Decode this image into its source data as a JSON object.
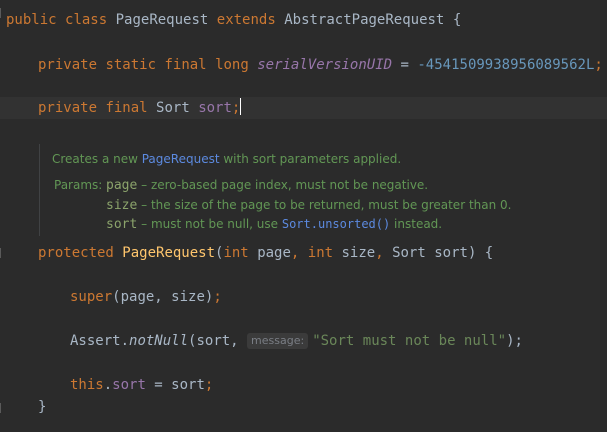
{
  "code": {
    "line1": {
      "kw1": "public",
      "kw2": "class",
      "name": "PageRequest",
      "kw3": "extends",
      "parent": "AbstractPageRequest",
      "brace": "{"
    },
    "line2": {
      "kw1": "private",
      "kw2": "static",
      "kw3": "final",
      "kw4": "long",
      "field": "serialVersionUID",
      "eq": " = ",
      "value": "-4541509938956089562L",
      "semi": ";"
    },
    "line3": {
      "kw1": "private",
      "kw2": "final",
      "type": "Sort",
      "field": "sort",
      "semi": ";"
    },
    "line4": {
      "kw1": "protected",
      "name": "PageRequest",
      "open": "(",
      "t1": "int",
      "p1": "page",
      "comma1": ", ",
      "t2": "int",
      "p2": "size",
      "comma2": ", ",
      "t3": "Sort",
      "p3": "sort",
      "close": ") {"
    },
    "line5": {
      "kw": "super",
      "args": "(page, size)",
      "semi": ";"
    },
    "line6": {
      "cls": "Assert",
      "dot": ".",
      "method": "notNull",
      "open": "(sort, ",
      "hint": "message:",
      "str": "\"Sort must not be null\"",
      "close": ");"
    },
    "line7": {
      "kw": "this",
      "rest": ".",
      "field": "sort",
      "assign": " = sort",
      "semi": ";"
    },
    "line8": {
      "brace": "}"
    }
  },
  "doc": {
    "intro_prefix": "Creates a new ",
    "intro_link": "PageRequest",
    "intro_suffix": " with sort parameters applied.",
    "params_label": "Params: ",
    "p1_name": "page",
    "p1_desc": " – zero-based page index, must not be negative.",
    "p2_name": "size",
    "p2_desc": " – the size of the page to be returned, must be greater than 0.",
    "p3_name": "sort",
    "p3_desc_prefix": " – must not be null, use ",
    "p3_link": "Sort.unsorted()",
    "p3_desc_suffix": " instead."
  },
  "colors": {
    "background": "#2b2b2b",
    "keyword": "#cc7832",
    "field": "#9876aa",
    "number": "#6897bb",
    "string": "#6a8759",
    "method": "#ffc66d",
    "doc": "#629755",
    "link": "#5c8ae0"
  }
}
